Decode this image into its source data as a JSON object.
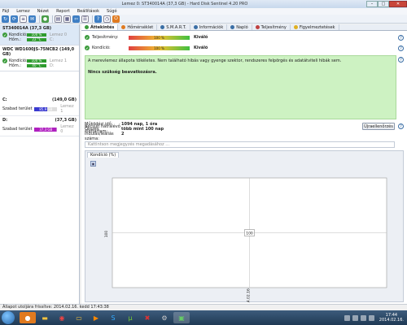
{
  "window": {
    "title": "Lemez 0: ST340014A (37,3 GB) - Hard Disk Sentinel 4.20 PRO"
  },
  "menu": [
    "Fájl",
    "Lemez",
    "Nézet",
    "Report",
    "Beállítások",
    "Súgó"
  ],
  "disks": [
    {
      "name": "ST340014A (37,3 GB)",
      "health_label": "Kondíció:",
      "health_value": "100 %",
      "health_ext": "Lemez 0",
      "temp_label": "Hőm.:",
      "temp_value": "22 °C",
      "temp_ext": "C:"
    },
    {
      "name": "WDC WD1600JS-75NCB2 (149,0 GB)",
      "health_label": "Kondíció:",
      "health_value": "100 %",
      "health_ext": "Lemez 1",
      "temp_label": "Hőm.:",
      "temp_value": "40 °C",
      "temp_ext": "D:"
    }
  ],
  "volumes": [
    {
      "name": "C:",
      "size": "(149,0 GB)",
      "free_label": "Szabad terület",
      "free_value": "85,9 GB",
      "free_pct": 0.58,
      "color": "#3a3ad0",
      "ext": "Lemez 1"
    },
    {
      "name": "D:",
      "size": "(37,3 GB)",
      "free_label": "Szabad terület",
      "free_value": "37,3 GB",
      "free_pct": 0.99,
      "color": "#b020c0",
      "ext": "Lemez 0"
    }
  ],
  "tabs": [
    {
      "label": "Áttekintés",
      "color": "#3b9b3b"
    },
    {
      "label": "Hőmérséklet",
      "color": "#e07a1f"
    },
    {
      "label": "S.M.A.R.T.",
      "color": "#3a6ea5"
    },
    {
      "label": "Információk",
      "color": "#3a6ea5"
    },
    {
      "label": "Napló",
      "color": "#3a6ea5"
    },
    {
      "label": "Teljesítmény",
      "color": "#c04040"
    },
    {
      "label": "Figyelmeztetések",
      "color": "#e0b020"
    }
  ],
  "overview": {
    "performance_label": "Teljesítmény:",
    "performance_value": "100 %",
    "performance_status": "Kiváló",
    "condition_label": "Kondíció:",
    "condition_value": "100 %",
    "condition_status": "Kiváló",
    "message": "A merevlemez állapota tökéletes. Nem található hibás vagy gyenge szektor, rendszeres felpörgés és adatátviteli hibák sem.",
    "message2": "Nincs szükség beavatkozásra.",
    "info": [
      {
        "key": "Működési idő:",
        "value": "1094 nap, 1 óra"
      },
      {
        "key": "Becsült hátralévő élettartam:",
        "value": "több mint 100 nap"
      },
      {
        "key": "Összes indulás/leállás száma:",
        "value": "2"
      }
    ],
    "details_button": "Újraellenőrzés",
    "comment_placeholder": "Kattintson megjegyzés megadásához ..."
  },
  "chart_tab": "Kondíció (%)",
  "chart_data": {
    "type": "line",
    "x": [
      "2014.02.16"
    ],
    "series": [
      {
        "values": [
          100
        ]
      }
    ],
    "ylabel": "100",
    "point_label": "100",
    "ylim": [
      0,
      200
    ]
  },
  "statusbar": "Állapot utoljára frissítve: 2014.02.16. kedd 17:43:38",
  "taskbar": {
    "time": "17:44",
    "date": "2014.02.16."
  },
  "colors": {
    "good": "#3b9b3b",
    "panel_green": "#cdf2c2"
  }
}
